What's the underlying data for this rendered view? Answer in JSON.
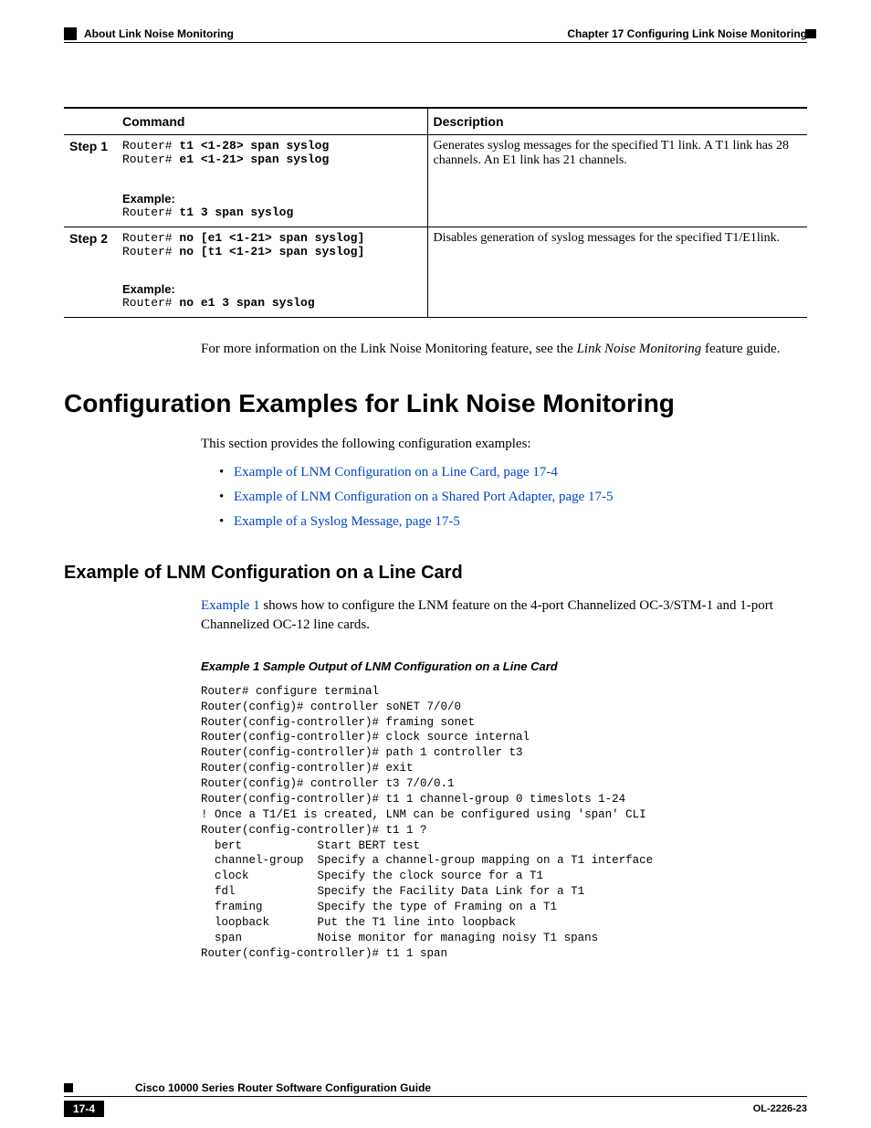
{
  "header": {
    "section_name": "About Link Noise Monitoring",
    "chapter": "Chapter 17    Configuring Link Noise Monitoring"
  },
  "table": {
    "col1": "Command",
    "col2": "Description",
    "rows": [
      {
        "step": "Step 1",
        "cmd_prefix1": "Router# ",
        "cmd_bold1": "t1 <1-28> span syslog",
        "cmd_prefix2": "Router# ",
        "cmd_bold2": "e1 <1-21> span syslog",
        "example_label": "Example:",
        "example_prefix": "Router# ",
        "example_bold": "t1 3 span syslog",
        "desc": "Generates syslog messages for the specified T1 link. A T1 link has 28 channels. An E1 link has 21 channels."
      },
      {
        "step": "Step 2",
        "cmd_prefix1": "Router# ",
        "cmd_bold1": "no [e1 <1-21> span syslog]",
        "cmd_prefix2": "Router# ",
        "cmd_bold2": "no [t1 <1-21> span syslog]",
        "example_label": "Example:",
        "example_prefix": "Router# ",
        "example_bold": "no e1 3 span syslog",
        "desc": "Disables generation of syslog messages for the specified T1/E1link."
      }
    ]
  },
  "body_note_pre": "For more information on the Link Noise Monitoring feature, see the ",
  "body_note_ital": "Link Noise Monitoring",
  "body_note_post": " feature guide.",
  "h1": "Configuration Examples for Link Noise Monitoring",
  "intro": "This section provides the following configuration examples:",
  "links": [
    "Example of LNM Configuration on a Line Card, page 17-4",
    "Example of LNM Configuration on a Shared Port Adapter, page 17-5",
    "Example of a Syslog Message, page 17-5"
  ],
  "h2": "Example of LNM Configuration on a Line Card",
  "ex_link": "Example 1",
  "ex_text": " shows how to configure the LNM feature on the 4-port Channelized OC-3/STM-1 and 1-port Channelized OC-12 line cards.",
  "example_title": "Example 1        Sample Output of LNM Configuration on a Line Card",
  "code": "Router# configure terminal\nRouter(config)# controller soNET 7/0/0\nRouter(config-controller)# framing sonet\nRouter(config-controller)# clock source internal\nRouter(config-controller)# path 1 controller t3\nRouter(config-controller)# exit\nRouter(config)# controller t3 7/0/0.1\nRouter(config-controller)# t1 1 channel-group 0 timeslots 1-24\n! Once a T1/E1 is created, LNM can be configured using 'span' CLI\nRouter(config-controller)# t1 1 ?\n  bert           Start BERT test\n  channel-group  Specify a channel-group mapping on a T1 interface\n  clock          Specify the clock source for a T1\n  fdl            Specify the Facility Data Link for a T1\n  framing        Specify the type of Framing on a T1\n  loopback       Put the T1 line into loopback\n  span           Noise monitor for managing noisy T1 spans\nRouter(config-controller)# t1 1 span",
  "footer": {
    "guide": "Cisco 10000 Series Router Software Configuration Guide",
    "page": "17-4",
    "docid": "OL-2226-23"
  }
}
